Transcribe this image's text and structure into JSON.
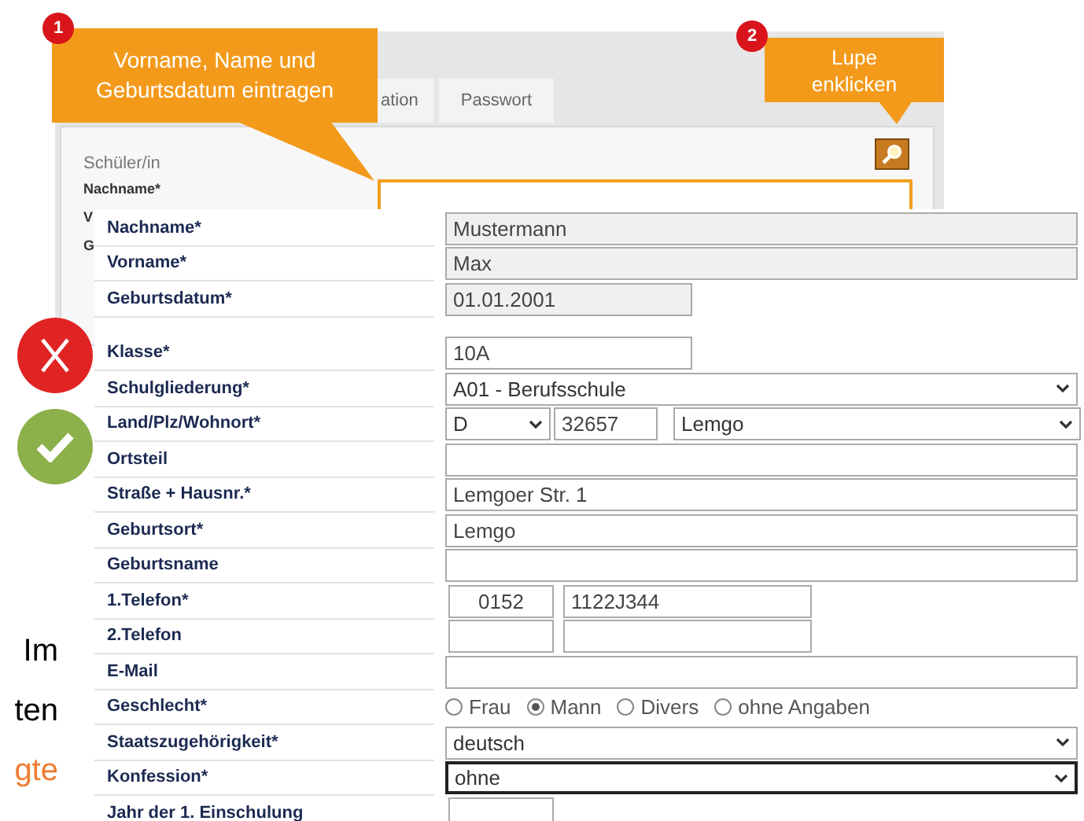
{
  "back_panel": {
    "tabs": [
      {
        "label": "ation",
        "selected": false
      },
      {
        "label": "Passwort",
        "selected": false
      }
    ],
    "section_title": "Schüler/in",
    "labels": [
      "Nachname*",
      "V",
      "G"
    ]
  },
  "callouts": [
    {
      "badge": "1",
      "text": "Vorname, Name und Geburtsdatum eintragen"
    },
    {
      "badge": "2",
      "text": "Lupe enklicken"
    }
  ],
  "form": {
    "groups": [
      [
        {
          "kind": "text",
          "label": "Nachname*",
          "value": "Mustermann",
          "readonly": true,
          "focused": false
        },
        {
          "kind": "text",
          "label": "Vorname*",
          "value": "Max",
          "readonly": true,
          "focused": false
        },
        {
          "kind": "short_text",
          "label": "Geburtsdatum*",
          "value": "01.01.2001",
          "readonly": true,
          "focused": false
        }
      ],
      [
        {
          "kind": "short_text",
          "label": "Klasse*",
          "value": "10A",
          "readonly": false,
          "focused": false
        },
        {
          "kind": "select",
          "label": "Schulgliederung*",
          "value": "A01 - Berufsschule",
          "focused": false
        },
        {
          "kind": "address",
          "label": "Land/Plz/Wohnort*",
          "country": "D",
          "zip": "32657",
          "city": "Lemgo"
        },
        {
          "kind": "text",
          "label": "Ortsteil",
          "readonly": false,
          "focused": false
        },
        {
          "kind": "text",
          "label": "Straße + Hausnr.*",
          "value": "Lemgoer Str. 1",
          "readonly": false,
          "focused": false
        },
        {
          "kind": "text",
          "label": "Geburtsort*",
          "value": "Lemgo",
          "readonly": false,
          "focused": false
        },
        {
          "kind": "text",
          "label": "Geburtsname",
          "readonly": false,
          "focused": false
        },
        {
          "kind": "phone",
          "label": "1.Telefon*",
          "prefix": "0152",
          "number": "1122J344"
        },
        {
          "kind": "phone",
          "label": "2.Telefon"
        },
        {
          "kind": "text",
          "label": "E-Mail",
          "readonly": false,
          "focused": false
        },
        {
          "kind": "radio",
          "label": "Geschlecht*",
          "options": [
            {
              "label": "Frau",
              "selected": false
            },
            {
              "label": "Mann",
              "selected": true
            },
            {
              "label": "Divers",
              "selected": false
            },
            {
              "label": "ohne Angaben",
              "selected": false
            }
          ]
        },
        {
          "kind": "select",
          "label": "Staatszugehörigkeit*",
          "value": "deutsch",
          "focused": false
        },
        {
          "kind": "select",
          "label": "Konfession*",
          "value": "ohne",
          "focused": true
        },
        {
          "kind": "tiny_text",
          "label": "Jahr der 1. Einschulung",
          "readonly": false,
          "focused": false
        }
      ]
    ]
  },
  "side_text": [
    {
      "text": "Im",
      "color": "#000000"
    },
    {
      "text": "ten",
      "color": "#000000"
    },
    {
      "text": "gte",
      "color": "#ed7d31"
    }
  ]
}
